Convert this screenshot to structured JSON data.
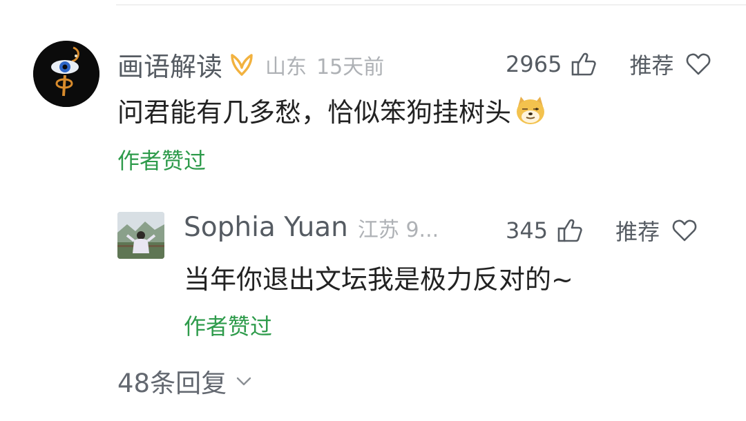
{
  "comment": {
    "author": "画语解读",
    "location": "山东",
    "time": "15天前",
    "likes": "2965",
    "recommend_label": "推荐",
    "text": "问君能有几多愁，恰似笨狗挂树头",
    "emoji": "doge-icon",
    "author_liked": "作者赞过"
  },
  "reply": {
    "author": "Sophia Yuan",
    "location_time": "江苏 9...",
    "likes": "345",
    "recommend_label": "推荐",
    "text": "当年你退出文坛我是极力反对的~",
    "author_liked": "作者赞过"
  },
  "replies_link": "48条回复",
  "colors": {
    "author_liked": "#2e9b4b",
    "badge": "#f2b23f",
    "muted": "#aeb1b5"
  }
}
